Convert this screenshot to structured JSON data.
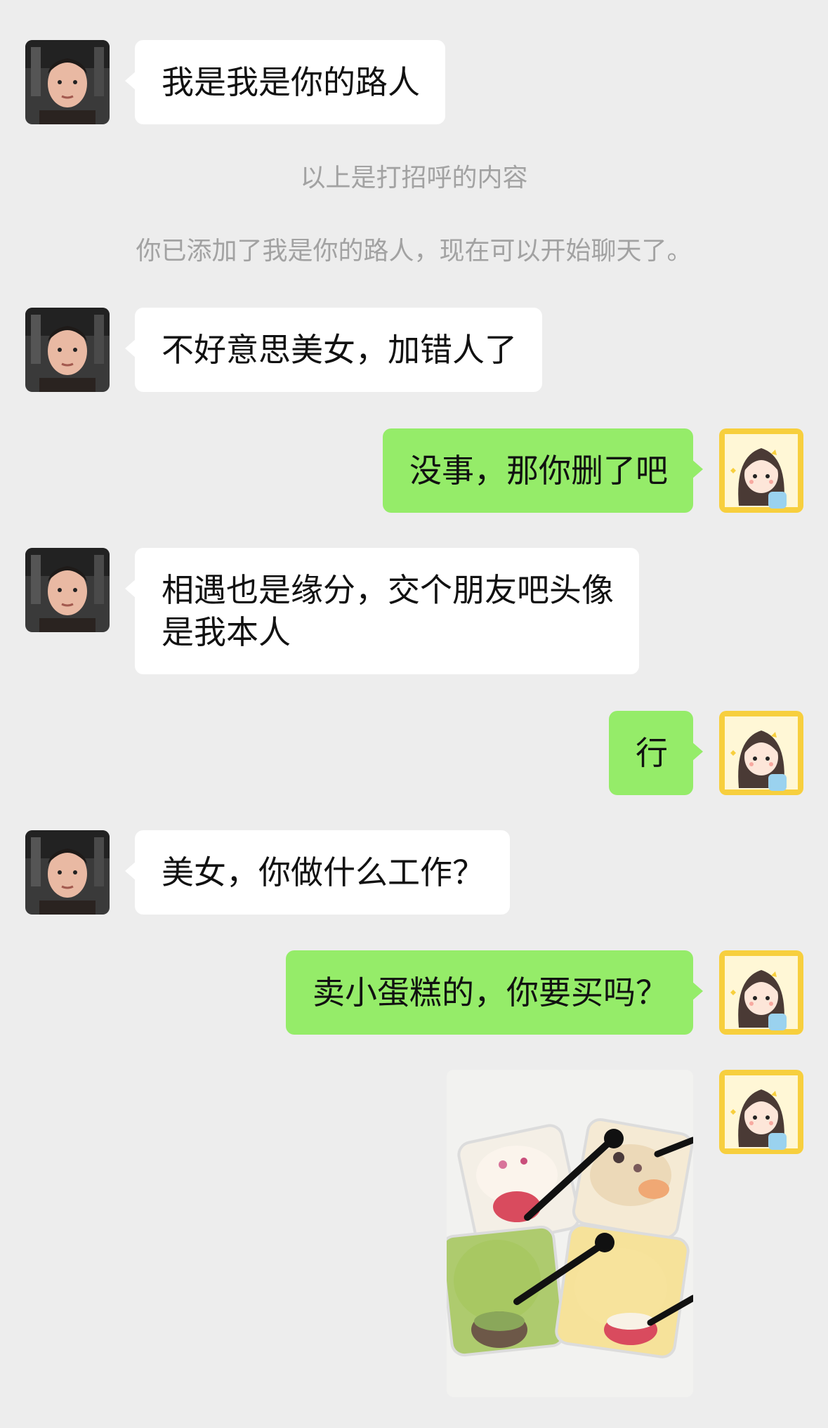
{
  "colors": {
    "background": "#ededed",
    "incoming_bubble": "#ffffff",
    "outgoing_bubble": "#95ec69",
    "system_text": "#a2a2a2"
  },
  "contact": {
    "avatar_icon": "male-selfie-avatar"
  },
  "me": {
    "avatar_icon": "cartoon-girl-avatar"
  },
  "messages": [
    {
      "side": "in",
      "text": "我是我是你的路人"
    },
    {
      "side": "system",
      "text": "以上是打招呼的内容"
    },
    {
      "side": "system",
      "text": "你已添加了我是你的路人，现在可以开始聊天了。"
    },
    {
      "side": "in",
      "text": "不好意思美女，加错人了"
    },
    {
      "side": "out",
      "text": "没事，那你删了吧"
    },
    {
      "side": "in",
      "text": "相遇也是缘分，交个朋友吧头像\n是我本人"
    },
    {
      "side": "out",
      "text": "行"
    },
    {
      "side": "in",
      "text": "美女，你做什么工作？"
    },
    {
      "side": "out",
      "text": "卖小蛋糕的，你要买吗？"
    },
    {
      "side": "out",
      "image": "cake-photo"
    }
  ]
}
